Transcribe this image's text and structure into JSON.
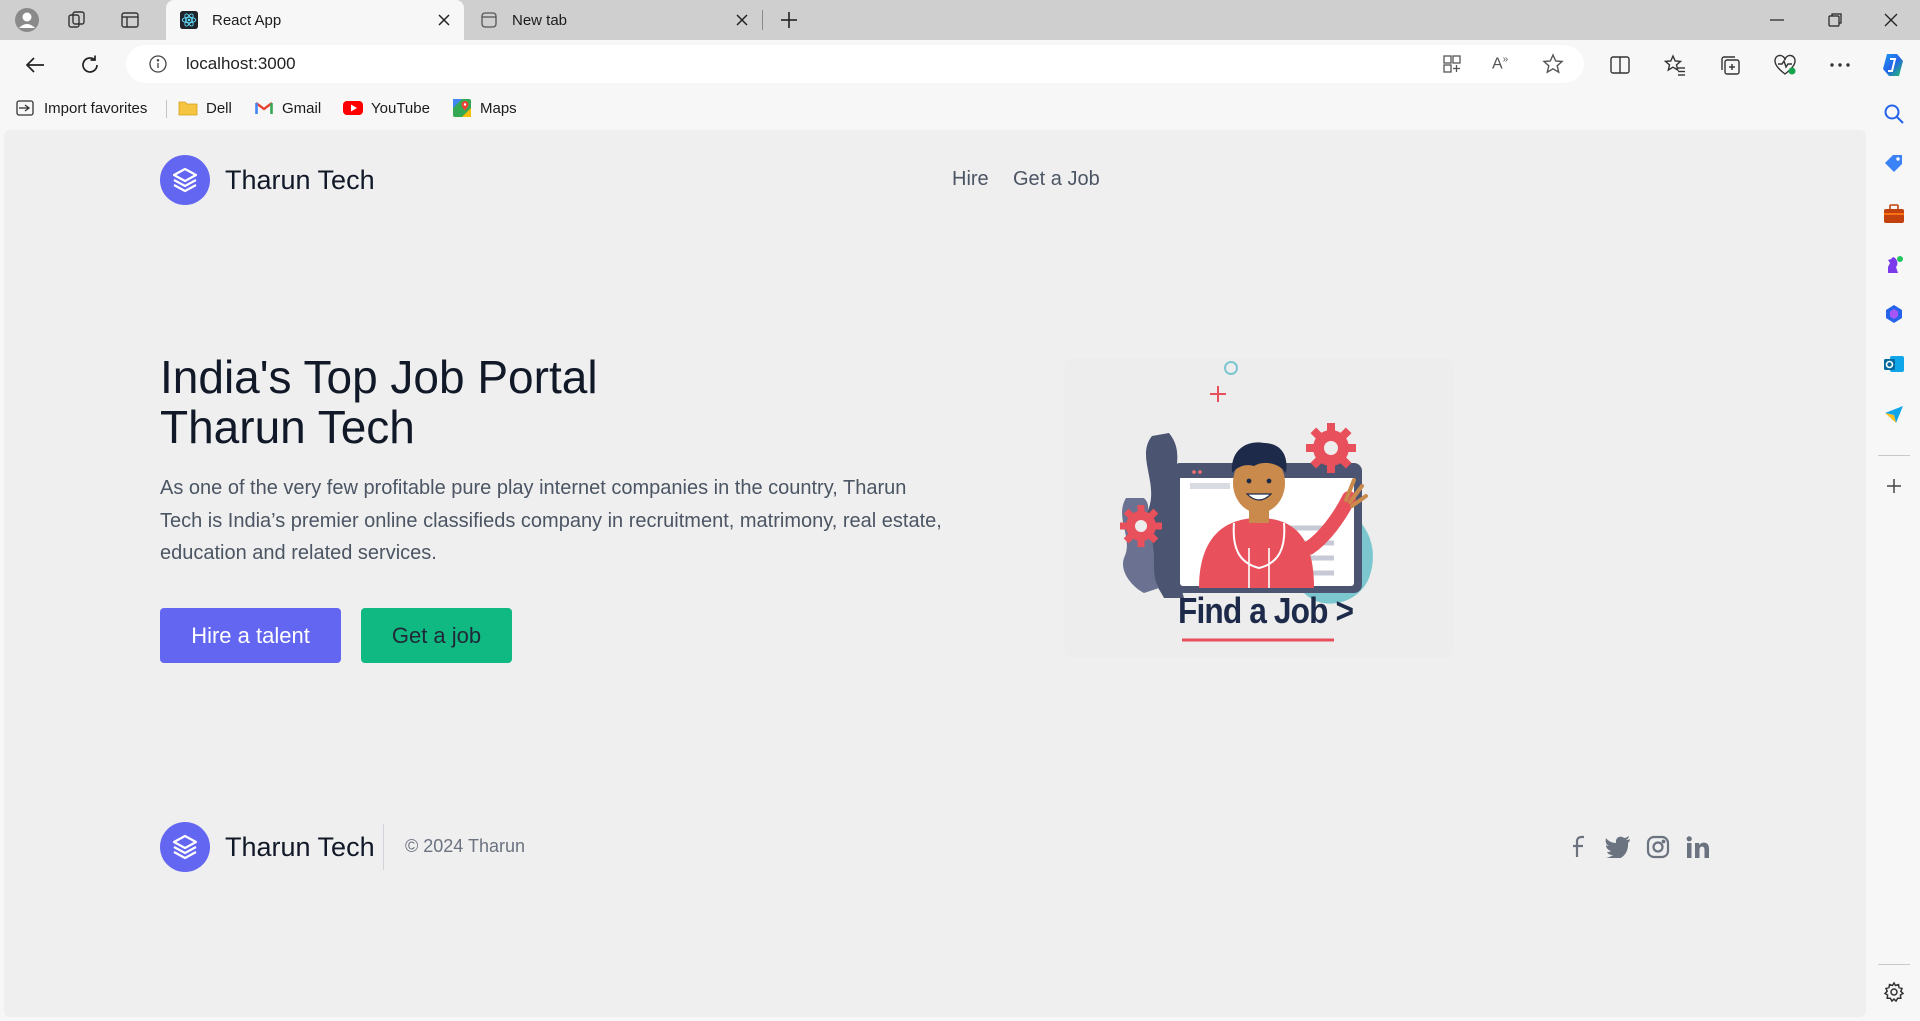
{
  "browser": {
    "tabs": [
      {
        "title": "React App",
        "active": true
      },
      {
        "title": "New tab",
        "active": false
      }
    ],
    "address": "localhost:3000",
    "bookmarks": [
      "Import favorites",
      "Dell",
      "Gmail",
      "YouTube",
      "Maps"
    ]
  },
  "site": {
    "brand": "Tharun Tech",
    "nav": [
      "Hire",
      "Get a Job"
    ],
    "hero": {
      "title_line1": "India's Top Job Portal",
      "title_line2": "Tharun Tech",
      "description": "As one of the very few profitable pure play internet companies in the country, Tharun Tech is India’s premier online classifieds company in recruitment, matrimony, real estate, education and related services.",
      "hire_button": "Hire a talent",
      "job_button": "Get a job"
    },
    "illustration_text": "Find a Job >",
    "footer": {
      "brand": "Tharun Tech",
      "copyright": "© 2024 Tharun",
      "social_icons": [
        "facebook-icon",
        "twitter-icon",
        "instagram-icon",
        "linkedin-icon"
      ]
    }
  },
  "colors": {
    "primary": "#6366f1",
    "secondary": "#10b981",
    "page_bg": "#efefef",
    "heading": "#111827",
    "body_text": "#4b5563"
  }
}
